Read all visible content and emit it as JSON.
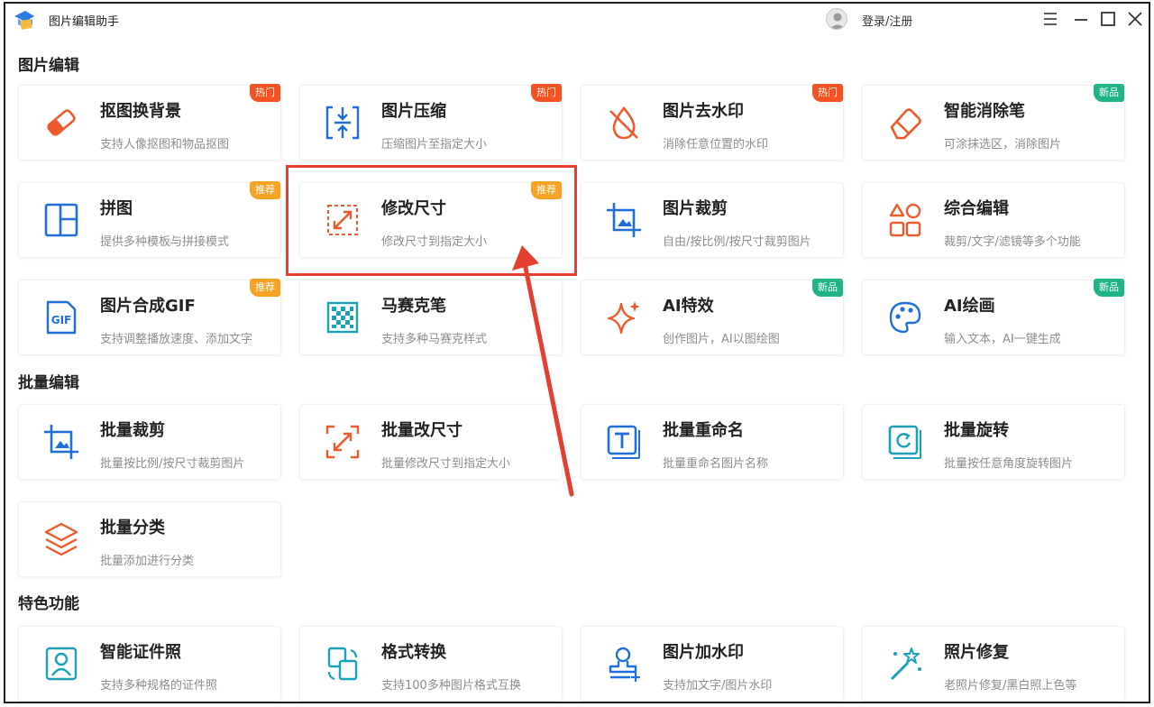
{
  "app": {
    "title": "图片编辑助手",
    "login_label": "登录/注册"
  },
  "window_controls": {
    "menu_icon": "menu-icon",
    "minimize_icon": "minimize-icon",
    "maximize_icon": "maximize-icon",
    "close_icon": "close-icon"
  },
  "sections": {
    "edit": "图片编辑",
    "batch": "批量编辑",
    "special": "特色功能"
  },
  "badges": {
    "hot": "热门",
    "rec": "推荐",
    "new": "新品"
  },
  "colors": {
    "accent_red": "#f2521f",
    "accent_orange": "#f6a323",
    "accent_green": "#1fb488",
    "accent_blue": "#1e6fd9",
    "highlight": "#e5402f"
  },
  "cards": {
    "cutout": {
      "title": "抠图换背景",
      "desc": "支持人像抠图和物品抠图",
      "icon": "eraser-icon"
    },
    "compress": {
      "title": "图片压缩",
      "desc": "压缩图片至指定大小",
      "icon": "compress-icon"
    },
    "watermark_remove": {
      "title": "图片去水印",
      "desc": "消除任意位置的水印",
      "icon": "drop-slash-icon"
    },
    "smart_eraser": {
      "title": "智能消除笔",
      "desc": "可涂抹选区，消除图片",
      "icon": "eraser-pen-icon"
    },
    "collage": {
      "title": "拼图",
      "desc": "提供多种模板与拼接模式",
      "icon": "layout-icon"
    },
    "resize": {
      "title": "修改尺寸",
      "desc": "修改尺寸到指定大小",
      "icon": "resize-icon"
    },
    "crop": {
      "title": "图片裁剪",
      "desc": "自由/按比例/按尺寸裁剪图片",
      "icon": "crop-icon"
    },
    "composite": {
      "title": "综合编辑",
      "desc": "裁剪/文字/滤镜等多个功能",
      "icon": "shapes-icon"
    },
    "gif": {
      "title": "图片合成GIF",
      "desc": "支持调整播放速度、添加文字",
      "icon": "gif-icon",
      "icon_text": "GIF"
    },
    "mosaic": {
      "title": "马赛克笔",
      "desc": "支持多种马赛克样式",
      "icon": "mosaic-icon"
    },
    "ai_effect": {
      "title": "AI特效",
      "desc": "创作图片，AI以图绘图",
      "icon": "sparkle-icon"
    },
    "ai_paint": {
      "title": "AI绘画",
      "desc": "输入文本，AI一键生成",
      "icon": "palette-icon"
    },
    "batch_crop": {
      "title": "批量裁剪",
      "desc": "批量按比例/按尺寸裁剪图片",
      "icon": "crop-icon"
    },
    "batch_resize": {
      "title": "批量改尺寸",
      "desc": "批量修改尺寸到指定大小",
      "icon": "resize-icon"
    },
    "batch_rename": {
      "title": "批量重命名",
      "desc": "批量重命名图片名称",
      "icon": "text-icon"
    },
    "batch_rotate": {
      "title": "批量旋转",
      "desc": "批量按任意角度旋转图片",
      "icon": "rotate-icon"
    },
    "batch_classify": {
      "title": "批量分类",
      "desc": "批量添加进行分类",
      "icon": "layers-icon"
    },
    "id_photo": {
      "title": "智能证件照",
      "desc": "支持多种规格的证件照",
      "icon": "portrait-icon"
    },
    "format_convert": {
      "title": "格式转换",
      "desc": "支持100多种图片格式互换",
      "icon": "convert-icon"
    },
    "add_watermark": {
      "title": "图片加水印",
      "desc": "支持加文字/图片水印",
      "icon": "stamp-icon"
    },
    "photo_repair": {
      "title": "照片修复",
      "desc": "老照片修复/黑白照上色等",
      "icon": "magic-wand-icon"
    }
  }
}
